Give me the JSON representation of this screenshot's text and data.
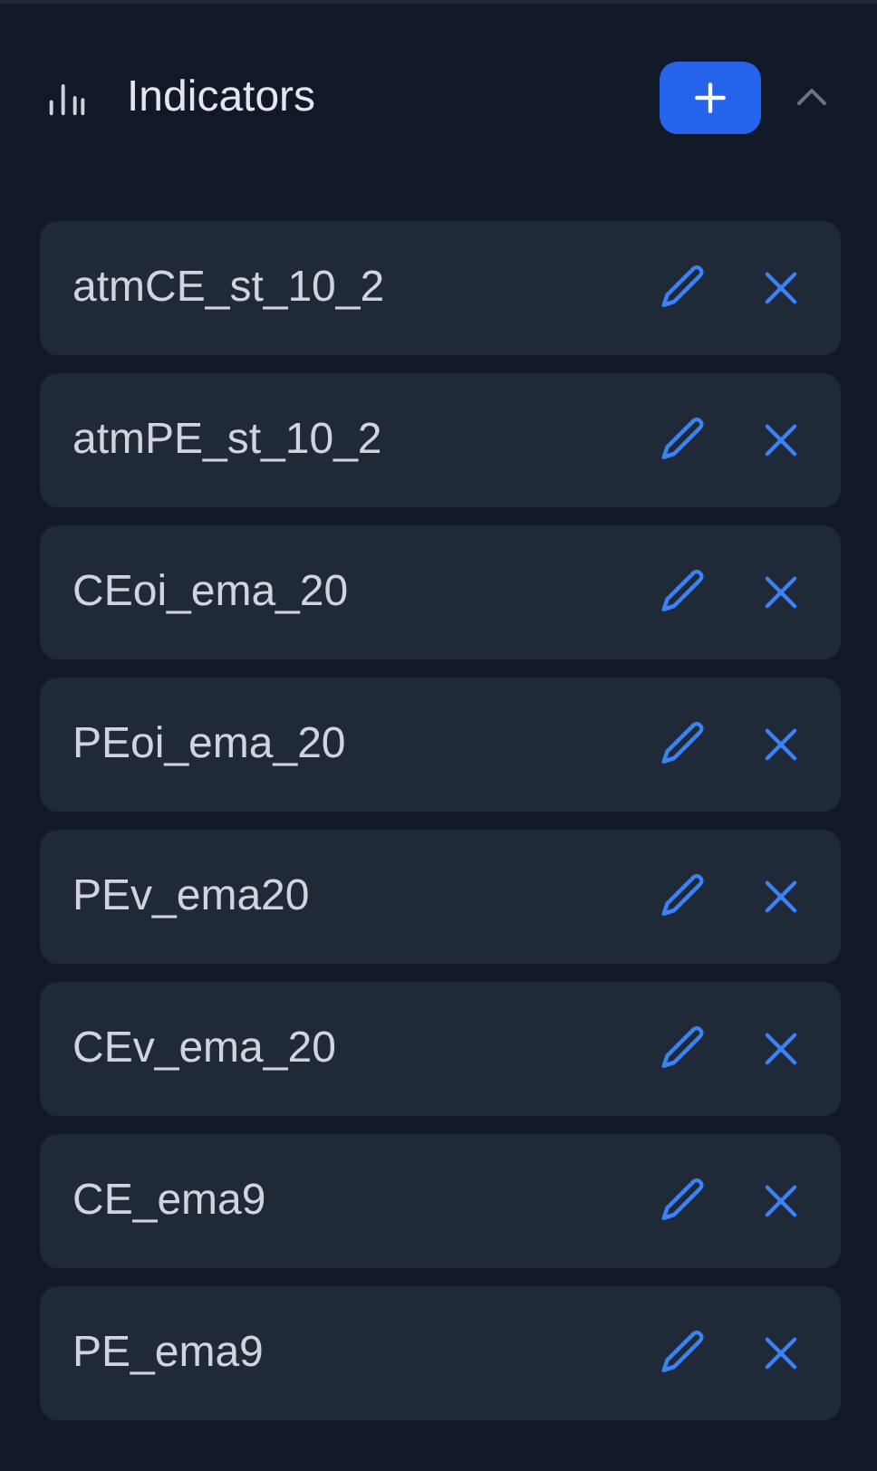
{
  "panel": {
    "title": "Indicators",
    "expanded": true
  },
  "indicators": [
    {
      "name": "atmCE_st_10_2"
    },
    {
      "name": "atmPE_st_10_2"
    },
    {
      "name": "CEoi_ema_20"
    },
    {
      "name": "PEoi_ema_20"
    },
    {
      "name": "PEv_ema20"
    },
    {
      "name": "CEv_ema_20"
    },
    {
      "name": "CE_ema9"
    },
    {
      "name": "PE_ema9"
    }
  ]
}
